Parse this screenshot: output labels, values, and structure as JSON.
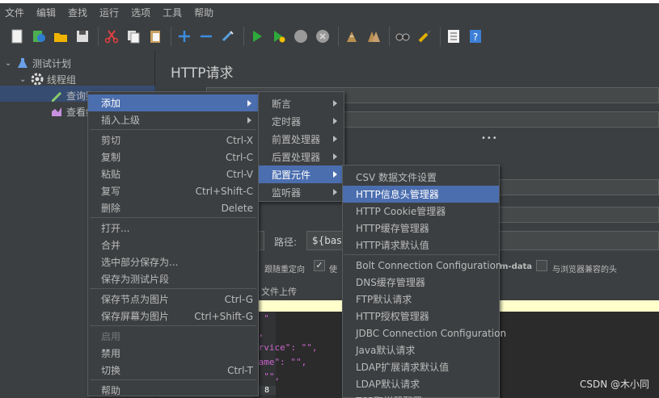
{
  "menubar": [
    "文件",
    "编辑",
    "查找",
    "运行",
    "选项",
    "工具",
    "帮助"
  ],
  "toolbar_icons": [
    "new-icon",
    "templates-icon",
    "open-icon",
    "save-icon",
    "cut-icon",
    "copy-icon",
    "paste-icon",
    "expand-icon",
    "collapse-icon",
    "toggle-icon",
    "start-icon",
    "start-no-pause-icon",
    "stop-icon",
    "shutdown-icon",
    "clear-icon",
    "clear-all-icon",
    "search-icon",
    "reset-search-icon",
    "function-helper-icon",
    "help-icon"
  ],
  "tree": {
    "root": "测试计划",
    "thread_group": "线程组",
    "sampler": "查询数据列表",
    "listener": "查看结果树"
  },
  "panel": {
    "title": "HTTP请求",
    "path_label": "路径:",
    "path_value": "${base",
    "redirect_label": "跟随重定向",
    "use_label": "使",
    "multipart_label": "m-data",
    "browser_headers_label": "与浏览器兼容的头",
    "file_upload_label": "文件上传",
    "code_line_number": "8"
  },
  "context_menu": [
    {
      "label": "添加",
      "submenu": true,
      "highlighted": true
    },
    {
      "label": "插入上级",
      "submenu": true
    },
    {
      "separator": true
    },
    {
      "label": "剪切",
      "shortcut": "Ctrl-X"
    },
    {
      "label": "复制",
      "shortcut": "Ctrl-C"
    },
    {
      "label": "粘贴",
      "shortcut": "Ctrl-V"
    },
    {
      "label": "复写",
      "shortcut": "Ctrl+Shift-C"
    },
    {
      "label": "删除",
      "shortcut": "Delete"
    },
    {
      "separator": true
    },
    {
      "label": "打开..."
    },
    {
      "label": "合并"
    },
    {
      "label": "选中部分保存为..."
    },
    {
      "label": "保存为测试片段"
    },
    {
      "separator": true
    },
    {
      "label": "保存节点为图片",
      "shortcut": "Ctrl-G"
    },
    {
      "label": "保存屏幕为图片",
      "shortcut": "Ctrl+Shift-G"
    },
    {
      "separator": true
    },
    {
      "label": "启用",
      "disabled": true
    },
    {
      "label": "禁用"
    },
    {
      "label": "切换",
      "shortcut": "Ctrl-T"
    },
    {
      "separator": true
    },
    {
      "label": "帮助"
    }
  ],
  "add_submenu": [
    {
      "label": "断言",
      "submenu": true
    },
    {
      "label": "定时器",
      "submenu": true
    },
    {
      "label": "前置处理器",
      "submenu": true
    },
    {
      "label": "后置处理器",
      "submenu": true
    },
    {
      "label": "配置元件",
      "submenu": true,
      "highlighted": true
    },
    {
      "label": "监听器",
      "submenu": true
    }
  ],
  "config_submenu": [
    {
      "label": "CSV 数据文件设置"
    },
    {
      "label": "HTTP信息头管理器",
      "highlighted": true
    },
    {
      "label": "HTTP Cookie管理器"
    },
    {
      "label": "HTTP缓存管理器"
    },
    {
      "label": "HTTP请求默认值"
    },
    {
      "separator": true
    },
    {
      "label": "Bolt Connection Configuration"
    },
    {
      "label": "DNS缓存管理器"
    },
    {
      "label": "FTP默认请求"
    },
    {
      "label": "HTTP授权管理器"
    },
    {
      "label": "JDBC Connection Configuration"
    },
    {
      "label": "Java默认请求"
    },
    {
      "label": "LDAP扩展请求默认值"
    },
    {
      "label": "LDAP默认请求"
    },
    {
      "label": "TCP取样器配置"
    }
  ],
  "watermark": "CSDN @木小同",
  "colors": {
    "background": "#3c3f41",
    "highlight": "#4b6eaf",
    "selection": "#2f65ca"
  }
}
